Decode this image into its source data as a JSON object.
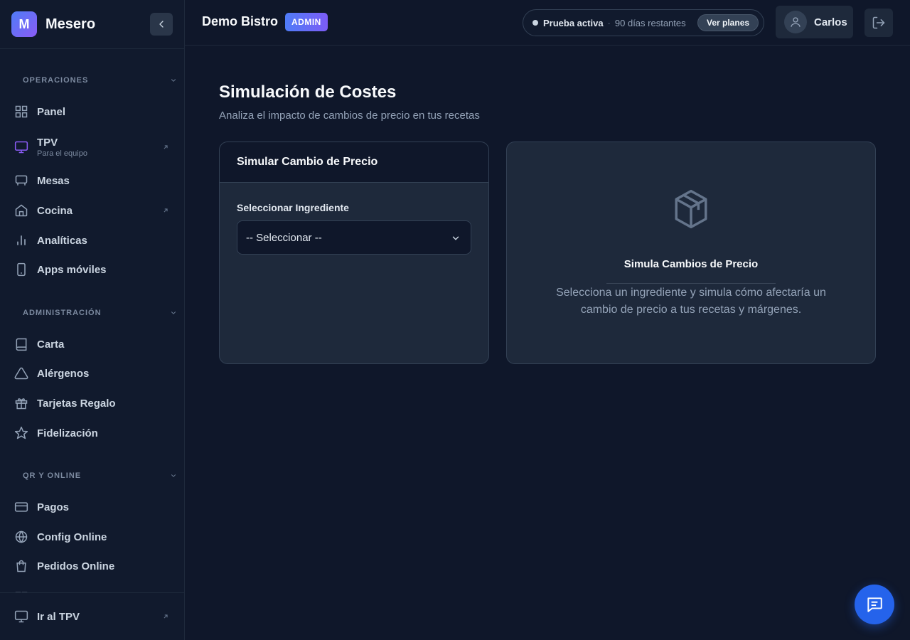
{
  "app": {
    "logo_letter": "M",
    "name": "Mesero"
  },
  "sidebar": {
    "sections": [
      {
        "title": "OPERACIONES"
      },
      {
        "title": "ADMINISTRACIÓN"
      },
      {
        "title": "QR Y ONLINE"
      }
    ],
    "items": [
      {
        "label": "Panel",
        "icon": "grid-icon"
      },
      {
        "label": "TPV",
        "sublabel": "Para el equipo",
        "icon": "monitor-icon",
        "external": true,
        "accent": "#8b5cf6"
      },
      {
        "label": "Mesas",
        "icon": "table-icon"
      },
      {
        "label": "Cocina",
        "icon": "home-icon",
        "external": true
      },
      {
        "label": "Analíticas",
        "icon": "bar-chart-icon"
      },
      {
        "label": "Apps móviles",
        "icon": "smartphone-icon"
      },
      {
        "label": "Carta",
        "icon": "book-icon"
      },
      {
        "label": "Alérgenos",
        "icon": "warning-icon"
      },
      {
        "label": "Tarjetas Regalo",
        "icon": "gift-icon"
      },
      {
        "label": "Fidelización",
        "icon": "star-icon"
      },
      {
        "label": "Pagos",
        "icon": "credit-card-icon"
      },
      {
        "label": "Config Online",
        "icon": "globe-icon"
      },
      {
        "label": "Pedidos Online",
        "icon": "shopping-bag-icon"
      }
    ],
    "footer": {
      "label": "Ir al TPV",
      "icon": "monitor-icon",
      "external": true
    }
  },
  "topbar": {
    "business_name": "Demo Bistro",
    "role_badge": "ADMIN",
    "trial": {
      "status": "Prueba activa",
      "separator": "·",
      "days_left": "90 días restantes",
      "plans_button": "Ver planes"
    },
    "user_name": "Carlos"
  },
  "main": {
    "title": "Simulación de Costes",
    "subtitle": "Analiza el impacto de cambios de precio en tus recetas",
    "simulate_card": {
      "title": "Simular Cambio de Precio",
      "field_label": "Seleccionar Ingrediente",
      "select_value": "-- Seleccionar --"
    },
    "empty_state": {
      "icon": "package-icon",
      "title": "Simula Cambios de Precio",
      "text": "Selecciona un ingrediente y simula cómo afectaría un cambio de precio a tus recetas y márgenes."
    }
  },
  "colors": {
    "background": "#0f172a",
    "sidebar": "#111a2d",
    "card": "#1e293b",
    "accent_blue": "#2563eb",
    "accent_purple": "#8b5cf6"
  }
}
